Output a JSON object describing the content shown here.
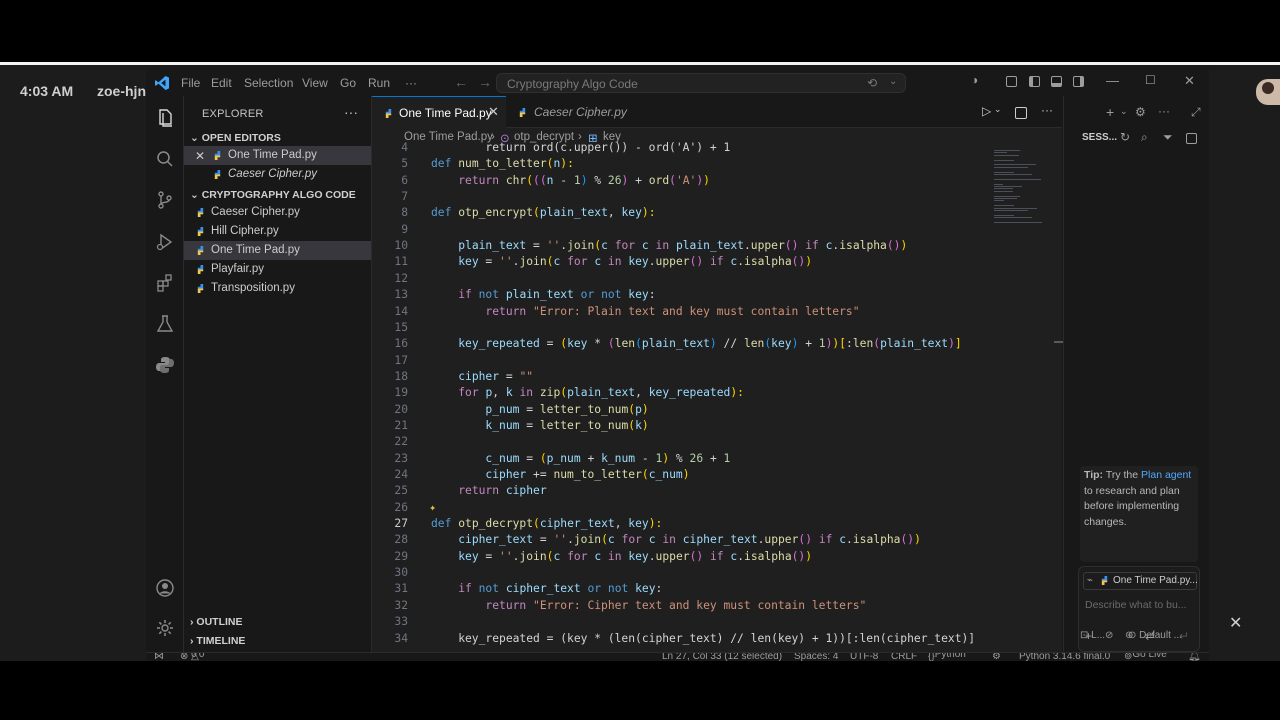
{
  "desktop": {
    "time": "4:03 AM",
    "user": "zoe-hjn"
  },
  "titlebar": {
    "menu": [
      "File",
      "Edit",
      "Selection",
      "View",
      "Go",
      "Run",
      "···"
    ],
    "search": "Cryptography Algo Code"
  },
  "explorer": {
    "title": "EXPLORER",
    "more": "···",
    "open_editors_header": "OPEN EDITORS",
    "open_editors": [
      {
        "label": "One Time Pad.py",
        "selected": true
      },
      {
        "label": "Caeser Cipher.py",
        "selected": false
      }
    ],
    "folder_header": "CRYPTOGRAPHY ALGO CODE",
    "files": [
      {
        "label": "Caeser Cipher.py",
        "selected": false
      },
      {
        "label": "Hill Cipher.py",
        "selected": false
      },
      {
        "label": "One Time Pad.py",
        "selected": true
      },
      {
        "label": "Playfair.py",
        "selected": false
      },
      {
        "label": "Transposition.py",
        "selected": false
      }
    ],
    "outline": "OUTLINE",
    "timeline": "TIMELINE"
  },
  "tabs": [
    {
      "label": "One Time Pad.py",
      "active": true
    },
    {
      "label": "Caeser Cipher.py",
      "active": false
    }
  ],
  "breadcrumb": {
    "file": "One Time Pad.py",
    "func": "otp_decrypt",
    "symbol": "key"
  },
  "code": {
    "current_line": 27,
    "lines": [
      [
        4,
        [
          [
            "        return ord(c.upper()) - ord('A') + 1",
            "op"
          ]
        ]
      ],
      [
        5,
        [
          [
            "def ",
            "kw"
          ],
          [
            "num_to_letter",
            "fn"
          ],
          [
            "(",
            "br1"
          ],
          [
            "n",
            "var"
          ],
          [
            "):",
            "br1"
          ]
        ]
      ],
      [
        6,
        [
          [
            "    ",
            " "
          ],
          [
            "return ",
            "ctl"
          ],
          [
            "chr",
            "fn"
          ],
          [
            "(",
            "br1"
          ],
          [
            "((",
            "br2"
          ],
          [
            "n",
            "var"
          ],
          [
            " - ",
            "op"
          ],
          [
            "1",
            "num"
          ],
          [
            ")",
            "br3"
          ],
          [
            " % ",
            "op"
          ],
          [
            "26",
            "num"
          ],
          [
            ")",
            "br2"
          ],
          [
            " + ",
            "op"
          ],
          [
            "ord",
            "fn"
          ],
          [
            "(",
            "br2"
          ],
          [
            "'A'",
            "str"
          ],
          [
            ")",
            "br2"
          ],
          [
            ")",
            "br1"
          ]
        ]
      ],
      [
        7,
        []
      ],
      [
        8,
        [
          [
            "def ",
            "kw"
          ],
          [
            "otp_encrypt",
            "fn"
          ],
          [
            "(",
            "br1"
          ],
          [
            "plain_text",
            "var"
          ],
          [
            ", ",
            "op"
          ],
          [
            "key",
            "var"
          ],
          [
            "):",
            "br1"
          ]
        ]
      ],
      [
        9,
        []
      ],
      [
        10,
        [
          [
            "    ",
            " "
          ],
          [
            "plain_text",
            "var"
          ],
          [
            " = ",
            "op"
          ],
          [
            "''",
            "str"
          ],
          [
            ".",
            "op"
          ],
          [
            "join",
            "fn"
          ],
          [
            "(",
            "br1"
          ],
          [
            "c ",
            "var"
          ],
          [
            "for ",
            "ctl"
          ],
          [
            "c ",
            "var"
          ],
          [
            "in ",
            "ctl"
          ],
          [
            "plain_text",
            "var"
          ],
          [
            ".",
            "op"
          ],
          [
            "upper",
            "fn"
          ],
          [
            "()",
            "br2"
          ],
          [
            " if ",
            "ctl"
          ],
          [
            "c",
            "var"
          ],
          [
            ".",
            "op"
          ],
          [
            "isalpha",
            "fn"
          ],
          [
            "()",
            "br2"
          ],
          [
            ")",
            "br1"
          ]
        ]
      ],
      [
        11,
        [
          [
            "    ",
            " "
          ],
          [
            "key",
            "var"
          ],
          [
            " = ",
            "op"
          ],
          [
            "''",
            "str"
          ],
          [
            ".",
            "op"
          ],
          [
            "join",
            "fn"
          ],
          [
            "(",
            "br1"
          ],
          [
            "c ",
            "var"
          ],
          [
            "for ",
            "ctl"
          ],
          [
            "c ",
            "var"
          ],
          [
            "in ",
            "ctl"
          ],
          [
            "key",
            "var"
          ],
          [
            ".",
            "op"
          ],
          [
            "upper",
            "fn"
          ],
          [
            "()",
            "br2"
          ],
          [
            " if ",
            "ctl"
          ],
          [
            "c",
            "var"
          ],
          [
            ".",
            "op"
          ],
          [
            "isalpha",
            "fn"
          ],
          [
            "()",
            "br2"
          ],
          [
            ")",
            "br1"
          ]
        ]
      ],
      [
        12,
        []
      ],
      [
        13,
        [
          [
            "    ",
            " "
          ],
          [
            "if ",
            "ctl"
          ],
          [
            "not ",
            "kw"
          ],
          [
            "plain_text",
            "var"
          ],
          [
            " or ",
            "kw"
          ],
          [
            "not ",
            "kw"
          ],
          [
            "key",
            "var"
          ],
          [
            ":",
            "op"
          ]
        ]
      ],
      [
        14,
        [
          [
            "        ",
            " "
          ],
          [
            "return ",
            "ctl"
          ],
          [
            "\"Error: Plain text and key must contain letters\"",
            "str"
          ]
        ]
      ],
      [
        15,
        []
      ],
      [
        16,
        [
          [
            "    ",
            " "
          ],
          [
            "key_repeated",
            "var"
          ],
          [
            " = ",
            "op"
          ],
          [
            "(",
            "br1"
          ],
          [
            "key",
            "var"
          ],
          [
            " * ",
            "op"
          ],
          [
            "(",
            "br2"
          ],
          [
            "len",
            "fn"
          ],
          [
            "(",
            "br3"
          ],
          [
            "plain_text",
            "var"
          ],
          [
            ")",
            "br3"
          ],
          [
            " // ",
            "op"
          ],
          [
            "len",
            "fn"
          ],
          [
            "(",
            "br3"
          ],
          [
            "key",
            "var"
          ],
          [
            ")",
            "br3"
          ],
          [
            " + ",
            "op"
          ],
          [
            "1",
            "num"
          ],
          [
            ")",
            "br2"
          ],
          [
            ")",
            "br1"
          ],
          [
            "[",
            "br1"
          ],
          [
            ":",
            "op"
          ],
          [
            "len",
            "fn"
          ],
          [
            "(",
            "br2"
          ],
          [
            "plain_text",
            "var"
          ],
          [
            ")",
            "br2"
          ],
          [
            "]",
            "br1"
          ]
        ]
      ],
      [
        17,
        []
      ],
      [
        18,
        [
          [
            "    ",
            " "
          ],
          [
            "cipher",
            "var"
          ],
          [
            " = ",
            "op"
          ],
          [
            "\"\"",
            "str"
          ]
        ]
      ],
      [
        19,
        [
          [
            "    ",
            " "
          ],
          [
            "for ",
            "ctl"
          ],
          [
            "p",
            "var"
          ],
          [
            ", ",
            "op"
          ],
          [
            "k ",
            "var"
          ],
          [
            "in ",
            "ctl"
          ],
          [
            "zip",
            "fn"
          ],
          [
            "(",
            "br1"
          ],
          [
            "plain_text",
            "var"
          ],
          [
            ", ",
            "op"
          ],
          [
            "key_repeated",
            "var"
          ],
          [
            "):",
            "br1"
          ]
        ]
      ],
      [
        20,
        [
          [
            "        ",
            " "
          ],
          [
            "p_num",
            "var"
          ],
          [
            " = ",
            "op"
          ],
          [
            "letter_to_num",
            "fn"
          ],
          [
            "(",
            "br1"
          ],
          [
            "p",
            "var"
          ],
          [
            ")",
            "br1"
          ]
        ]
      ],
      [
        21,
        [
          [
            "        ",
            " "
          ],
          [
            "k_num",
            "var"
          ],
          [
            " = ",
            "op"
          ],
          [
            "letter_to_num",
            "fn"
          ],
          [
            "(",
            "br1"
          ],
          [
            "k",
            "var"
          ],
          [
            ")",
            "br1"
          ]
        ]
      ],
      [
        22,
        []
      ],
      [
        23,
        [
          [
            "        ",
            " "
          ],
          [
            "c_num",
            "var"
          ],
          [
            " = ",
            "op"
          ],
          [
            "(",
            "br1"
          ],
          [
            "p_num",
            "var"
          ],
          [
            " + ",
            "op"
          ],
          [
            "k_num",
            "var"
          ],
          [
            " - ",
            "op"
          ],
          [
            "1",
            "num"
          ],
          [
            ")",
            "br1"
          ],
          [
            " % ",
            "op"
          ],
          [
            "26",
            "num"
          ],
          [
            " + ",
            "op"
          ],
          [
            "1",
            "num"
          ]
        ]
      ],
      [
        24,
        [
          [
            "        ",
            " "
          ],
          [
            "cipher",
            "var"
          ],
          [
            " += ",
            "op"
          ],
          [
            "num_to_letter",
            "fn"
          ],
          [
            "(",
            "br1"
          ],
          [
            "c_num",
            "var"
          ],
          [
            ")",
            "br1"
          ]
        ]
      ],
      [
        25,
        [
          [
            "    ",
            " "
          ],
          [
            "return ",
            "ctl"
          ],
          [
            "cipher",
            "var"
          ]
        ]
      ],
      [
        26,
        []
      ],
      [
        27,
        [
          [
            "def ",
            "kw"
          ],
          [
            "otp_decrypt",
            "fn"
          ],
          [
            "(",
            "br1"
          ],
          [
            "cipher_text",
            "var"
          ],
          [
            ", ",
            "op"
          ],
          [
            "key",
            "var"
          ],
          [
            "):",
            "br1"
          ]
        ]
      ],
      [
        28,
        [
          [
            "    ",
            " "
          ],
          [
            "cipher_text",
            "var"
          ],
          [
            " = ",
            "op"
          ],
          [
            "''",
            "str"
          ],
          [
            ".",
            "op"
          ],
          [
            "join",
            "fn"
          ],
          [
            "(",
            "br1"
          ],
          [
            "c ",
            "var"
          ],
          [
            "for ",
            "ctl"
          ],
          [
            "c ",
            "var"
          ],
          [
            "in ",
            "ctl"
          ],
          [
            "cipher_text",
            "var"
          ],
          [
            ".",
            "op"
          ],
          [
            "upper",
            "fn"
          ],
          [
            "()",
            "br2"
          ],
          [
            " if ",
            "ctl"
          ],
          [
            "c",
            "var"
          ],
          [
            ".",
            "op"
          ],
          [
            "isalpha",
            "fn"
          ],
          [
            "()",
            "br2"
          ],
          [
            ")",
            "br1"
          ]
        ]
      ],
      [
        29,
        [
          [
            "    ",
            " "
          ],
          [
            "key",
            "var"
          ],
          [
            " = ",
            "op"
          ],
          [
            "''",
            "str"
          ],
          [
            ".",
            "op"
          ],
          [
            "join",
            "fn"
          ],
          [
            "(",
            "br1"
          ],
          [
            "c ",
            "var"
          ],
          [
            "for ",
            "ctl"
          ],
          [
            "c ",
            "var"
          ],
          [
            "in ",
            "ctl"
          ],
          [
            "key",
            "var"
          ],
          [
            ".",
            "op"
          ],
          [
            "upper",
            "fn"
          ],
          [
            "()",
            "br2"
          ],
          [
            " if ",
            "ctl"
          ],
          [
            "c",
            "var"
          ],
          [
            ".",
            "op"
          ],
          [
            "isalpha",
            "fn"
          ],
          [
            "()",
            "br2"
          ],
          [
            ")",
            "br1"
          ]
        ]
      ],
      [
        30,
        []
      ],
      [
        31,
        [
          [
            "    ",
            " "
          ],
          [
            "if ",
            "ctl"
          ],
          [
            "not ",
            "kw"
          ],
          [
            "cipher_text",
            "var"
          ],
          [
            " or ",
            "kw"
          ],
          [
            "not ",
            "kw"
          ],
          [
            "key",
            "var"
          ],
          [
            ":",
            "op"
          ]
        ]
      ],
      [
        32,
        [
          [
            "        ",
            " "
          ],
          [
            "return ",
            "ctl"
          ],
          [
            "\"Error: Cipher text and key must contain letters\"",
            "str"
          ]
        ]
      ],
      [
        33,
        []
      ],
      [
        34,
        [
          [
            "    key_repeated = (key * (len(cipher_text) // len(key) + 1))[:len(cipher_text)]",
            "op"
          ]
        ]
      ]
    ]
  },
  "chat": {
    "title": "SESS...",
    "tip_prefix": "Tip:",
    "tip_try": "Try the",
    "tip_link": "Plan agent",
    "tip_rest": "to research and plan before implementing changes.",
    "context_chip": "One Time Pad.py...",
    "placeholder": "Describe what to bu...",
    "footer_left": "L...",
    "footer_right": "Default ..."
  },
  "statusbar": {
    "errors": "0",
    "warnings": "0",
    "position": "Ln 27, Col 33 (12 selected)",
    "spaces": "Spaces: 4",
    "encoding": "UTF-8",
    "eol": "CRLF",
    "language": "Python",
    "interpreter": "Python 3.14.6 final.0",
    "golive": "Go Live"
  },
  "colors": {
    "accent": "#0078d4",
    "python_blue": "#3b8eea",
    "python_yellow": "#f0c94a"
  }
}
